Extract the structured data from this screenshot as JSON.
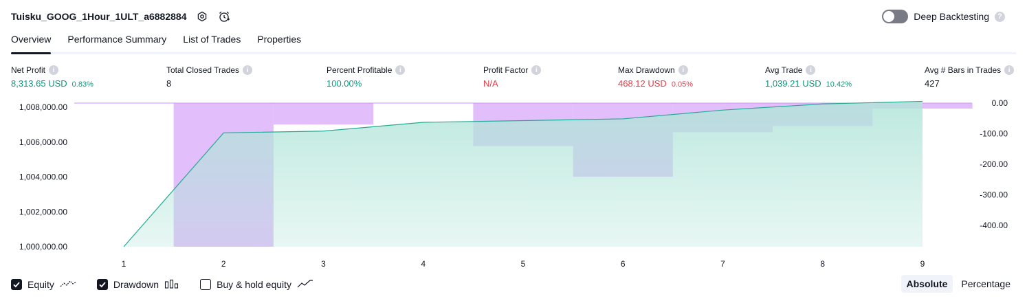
{
  "header": {
    "title": "Tuisku_GOOG_1Hour_1ULT_a6882884",
    "deep_backtesting_label": "Deep Backtesting",
    "help_glyph": "?"
  },
  "tabs": [
    {
      "label": "Overview",
      "active": true
    },
    {
      "label": "Performance Summary",
      "active": false
    },
    {
      "label": "List of Trades",
      "active": false
    },
    {
      "label": "Properties",
      "active": false
    }
  ],
  "metrics": {
    "net_profit": {
      "label": "Net Profit",
      "value": "8,313.65 USD",
      "pct": "0.83%"
    },
    "total_closed_trades": {
      "label": "Total Closed Trades",
      "value": "8"
    },
    "percent_profitable": {
      "label": "Percent Profitable",
      "value": "100.00%"
    },
    "profit_factor": {
      "label": "Profit Factor",
      "value": "N/A"
    },
    "max_drawdown": {
      "label": "Max Drawdown",
      "value": "468.12 USD",
      "pct": "0.05%"
    },
    "avg_trade": {
      "label": "Avg Trade",
      "value": "1,039.21 USD",
      "pct": "10.42%"
    },
    "avg_bars": {
      "label": "Avg # Bars in Trades",
      "value": "427"
    },
    "info_glyph": "i"
  },
  "legend": {
    "equity": "Equity",
    "drawdown": "Drawdown",
    "buy_hold": "Buy & hold equity",
    "equity_checked": true,
    "drawdown_checked": true,
    "buy_hold_checked": false
  },
  "mode": {
    "absolute": "Absolute",
    "percentage": "Percentage",
    "active": "Absolute"
  },
  "colors": {
    "green": "#089981",
    "red": "#f23645",
    "equity_line": "#22ab94",
    "equity_fill": "#b2e5d9",
    "drawdown_bar": "#ce93f8"
  },
  "chart_data": {
    "type": "area",
    "x": [
      1,
      2,
      3,
      4,
      5,
      6,
      7,
      8,
      9
    ],
    "series": [
      {
        "name": "Equity",
        "axis": "left",
        "type": "area",
        "values": [
          1000000,
          1006500,
          1006600,
          1007100,
          1007200,
          1007300,
          1007800,
          1008150,
          1008300
        ]
      },
      {
        "name": "Drawdown",
        "axis": "right",
        "type": "bar",
        "values": [
          -468,
          -70,
          0,
          -140,
          -240,
          -95,
          -75,
          -18
        ]
      }
    ],
    "y_left_ticks": [
      "1,008,000.00",
      "1,006,000.00",
      "1,004,000.00",
      "1,002,000.00",
      "1,000,000.00"
    ],
    "y_right_ticks": [
      "0.00",
      "-100.00",
      "-200.00",
      "-300.00",
      "-400.00"
    ],
    "x_ticks": [
      "1",
      "2",
      "3",
      "4",
      "5",
      "6",
      "7",
      "8",
      "9"
    ],
    "y_left_range": [
      1000000,
      1008200
    ],
    "y_right_range": [
      -468,
      0
    ],
    "grid": false
  }
}
